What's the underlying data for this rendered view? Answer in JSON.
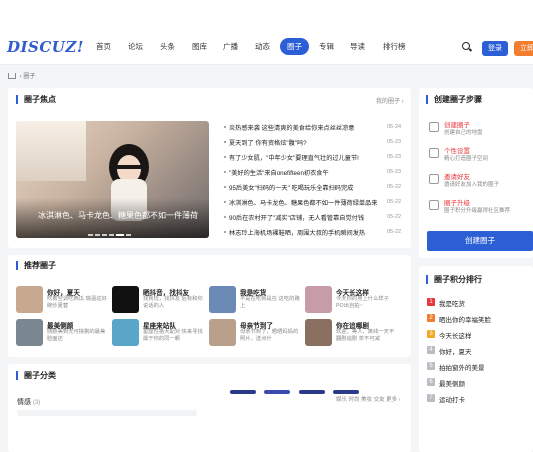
{
  "header": {
    "logo": "DISCUZ!",
    "nav": [
      "首页",
      "论坛",
      "头条",
      "图库",
      "广播",
      "动态",
      "圈子",
      "专辑",
      "导读",
      "排行榜"
    ],
    "active_index": 6,
    "login": "登录",
    "register": "立即"
  },
  "breadcrumb": {
    "current": "圈子"
  },
  "focus": {
    "title": "圈子焦点",
    "more": "我的圈子 ›",
    "banner_caption": "冰淇淋色、马卡龙色、糖果色都不如一件薄荷",
    "news": [
      {
        "text": "炎热感来袭 这些清爽的美食给你来点丝丝凉意",
        "date": "05-24"
      },
      {
        "text": "夏天到了 你有资格炫\"腹\"吗?",
        "date": "05-23"
      },
      {
        "text": "有了少女肌，\"中年少女\"要理直气壮的过儿童节!",
        "date": "05-23"
      },
      {
        "text": "\"美好的生活\"来自onefifteen初衣食午",
        "date": "05-23"
      },
      {
        "text": "95后美女\"扫码的一天\" 吃喝玩乐全靠扫码完成",
        "date": "05-22"
      },
      {
        "text": "冰淇淋色、马卡龙色、糖果色都不如一件薄荷绿单品来",
        "date": "05-22"
      },
      {
        "text": "90后在农村开了\"减实\"店铺，无人看管靠自觉付钱",
        "date": "05-22"
      },
      {
        "text": "林志玲上海机场裸鞋晒，周围大叔的手机瞬间发热",
        "date": "05-22"
      }
    ]
  },
  "steps": {
    "title": "创建圈子步骤",
    "items": [
      {
        "title": "创建圈子",
        "desc": "创建自己的地盘",
        "icon": "hand-icon"
      },
      {
        "title": "个性设置",
        "desc": "精心打造圈子空间",
        "icon": "gear-icon"
      },
      {
        "title": "邀请好友",
        "desc": "邀请好友加入我的圈子",
        "icon": "invite-icon"
      },
      {
        "title": "圈子升级",
        "desc": "圈子积分升级赢得社区推荐",
        "icon": "thumb-icon"
      }
    ],
    "create_button": "创建圈子"
  },
  "recommend": {
    "title": "推荐圈子",
    "items": [
      {
        "name": "你好，夏天",
        "desc": "吹着空调吃西瓜 瑞温这好碗炒夏替",
        "color": "#c8a98f"
      },
      {
        "name": "晒抖音，找抖友",
        "desc": "找我玩，找抖友 后有和你说话的人",
        "color": "#111111"
      },
      {
        "name": "我是吃货",
        "desc": "不是在吃就是在 这吃的路上",
        "color": "#6a8ab5"
      },
      {
        "name": "今天长这样",
        "desc": "今天你的身上什么样子 PO出自拍~",
        "color": "#c89ca6"
      },
      {
        "name": "最美侧颜",
        "desc": "侧颜美到无可挑剔的最美脸面还",
        "color": "#7a8690"
      },
      {
        "name": "星座来站队",
        "desc": "星座性格大配对 快来寻找属于你的同一颗",
        "color": "#5aa6c8"
      },
      {
        "name": "母亲节到了",
        "desc": "母亲节到了，晒晒妈妈的照片，送点什",
        "color": "#b8a08a"
      },
      {
        "name": "你在追哪剧",
        "desc": "欢迎、等人、离线一天不翻剧追剧 茶不可减",
        "color": "#8a7060"
      }
    ]
  },
  "ranking": {
    "title": "圈子积分排行",
    "items": [
      {
        "num": "1",
        "name": "我是吃货",
        "color": "#e8383d"
      },
      {
        "num": "2",
        "name": "晒出你的幸福笑脸",
        "color": "#f37d2e"
      },
      {
        "num": "3",
        "name": "今天长这样",
        "color": "#f5a623"
      },
      {
        "num": "4",
        "name": "你好，夏天",
        "color": "#b9bdc4"
      },
      {
        "num": "5",
        "name": "拍拍窗外的美景",
        "color": "#b9bdc4"
      },
      {
        "num": "6",
        "name": "最美侧颜",
        "color": "#b9bdc4"
      },
      {
        "num": "7",
        "name": "运动打卡",
        "color": "#b9bdc4"
      }
    ]
  },
  "category": {
    "title": "圈子分类",
    "group": "情感",
    "count": "(3)",
    "tabs": "娱乐 时尚 美妆 交友 更多 ›"
  }
}
